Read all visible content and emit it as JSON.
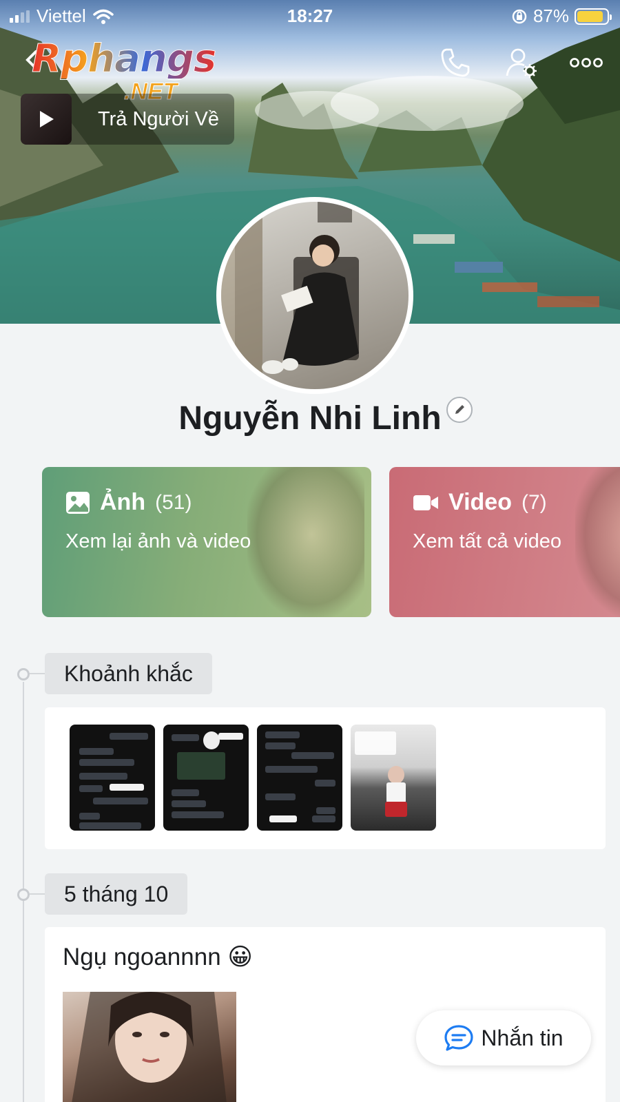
{
  "status_bar": {
    "carrier": "Viettel",
    "time": "18:27",
    "battery_percent": "87%",
    "battery_level": 0.87
  },
  "logo": {
    "main": "Rphangs",
    "sub": ".NET"
  },
  "music": {
    "title": "Trả Người Về"
  },
  "profile": {
    "name": "Nguyễn Nhi Linh"
  },
  "media": {
    "photos": {
      "label": "Ảnh",
      "count": "(51)",
      "subtitle": "Xem lại ảnh và video"
    },
    "videos": {
      "label": "Video",
      "count": "(7)",
      "subtitle": "Xem tất cả video"
    }
  },
  "timeline": {
    "moments_label": "Khoảnh khắc",
    "date_label": "5 tháng 10",
    "post_text": "Ngụ ngoannnn 😀"
  },
  "chat_button": {
    "label": "Nhắn tin"
  },
  "icons": {
    "back": "chevron-left-icon",
    "call": "phone-icon",
    "settings": "user-settings-icon",
    "more": "more-icon",
    "play": "play-icon",
    "edit": "pencil-icon",
    "photo": "image-icon",
    "video": "video-camera-icon",
    "chat": "chat-bubble-icon"
  },
  "colors": {
    "accent": "#1d7cf2",
    "photo_card": "#6fa57a",
    "video_card": "#cc7580",
    "battery": "#f7d23e"
  }
}
